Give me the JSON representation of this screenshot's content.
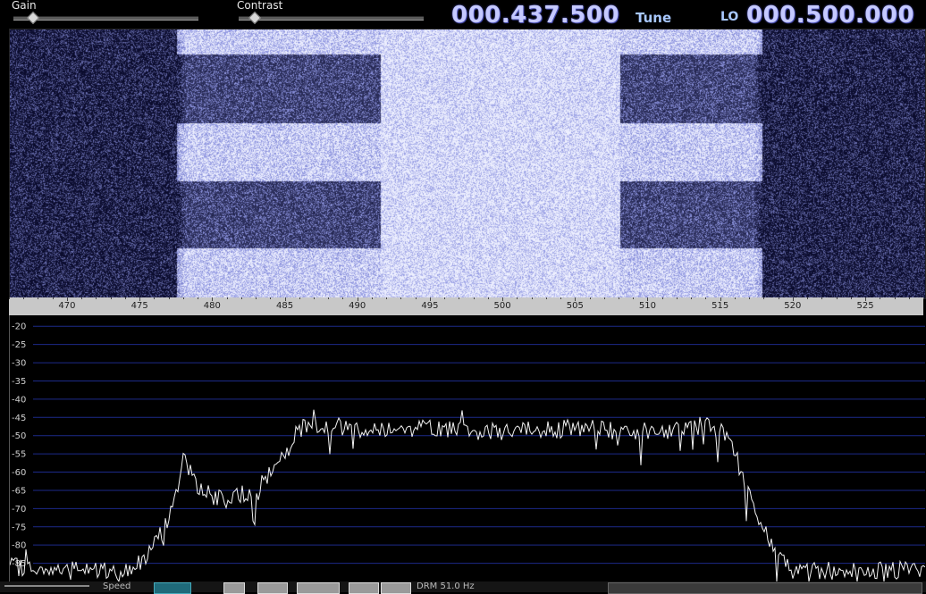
{
  "controls": {
    "gain": {
      "label": "Gain",
      "value": 0.1
    },
    "contrast": {
      "label": "Contrast",
      "value": 0.08
    }
  },
  "tune": {
    "frequency": "000.437.500",
    "label": "Tune"
  },
  "lo": {
    "label": "LO",
    "frequency": "000.500.000"
  },
  "waterfall": {
    "colors": {
      "bright": "#eef0ff",
      "mid": "#8c93e0",
      "dark": "#0b0c2e"
    }
  },
  "frequency_axis": {
    "unit": "kHz",
    "ticks": [
      "470",
      "475",
      "480",
      "485",
      "490",
      "495",
      "500",
      "505",
      "510",
      "515",
      "520",
      "525"
    ]
  },
  "spectrum": {
    "y_ticks": [
      "-20",
      "-25",
      "-30",
      "-35",
      "-40",
      "-45",
      "-50",
      "-55",
      "-60",
      "-65",
      "-70",
      "-75",
      "-80",
      "-85"
    ],
    "grid_color": "#1c2a8a",
    "trace_color": "#f2f2f2"
  },
  "chart_data": {
    "type": "line",
    "x": [
      466,
      470,
      474,
      475,
      476,
      477,
      478,
      479,
      480,
      481,
      482,
      483,
      484,
      485,
      486,
      487,
      488,
      490,
      495,
      500,
      505,
      510,
      512,
      514,
      515,
      516,
      517,
      518,
      519,
      520,
      525,
      529
    ],
    "series": [
      {
        "values": [
          -86,
          -87,
          -87,
          -85,
          -80,
          -72,
          -56,
          -64,
          -67,
          -68,
          -66,
          -65,
          -60,
          -53,
          -48,
          -47,
          -47,
          -48,
          -48,
          -49,
          -48,
          -49,
          -48,
          -47,
          -49,
          -56,
          -68,
          -78,
          -84,
          -87,
          -87,
          -87
        ]
      }
    ],
    "xlim": [
      466,
      529
    ],
    "ylim": [
      -90,
      -17
    ],
    "grid": true
  },
  "bottom": {
    "labels": [
      "Speed",
      "DRM 51.0 Hz"
    ]
  }
}
